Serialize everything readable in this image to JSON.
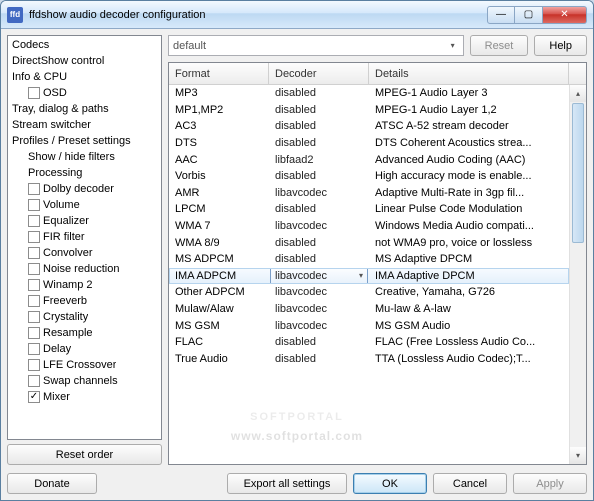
{
  "window": {
    "title": "ffdshow audio decoder configuration",
    "app_icon": "ffd"
  },
  "window_controls": {
    "min": "—",
    "max": "▢",
    "close": "✕"
  },
  "preset": {
    "value": "default",
    "reset": "Reset",
    "help": "Help"
  },
  "tree": {
    "reset_order": "Reset order",
    "items": [
      {
        "indent": 0,
        "label": "Codecs"
      },
      {
        "indent": 0,
        "label": "DirectShow control"
      },
      {
        "indent": 0,
        "label": "Info & CPU"
      },
      {
        "indent": 1,
        "checkbox": true,
        "checked": false,
        "label": "OSD"
      },
      {
        "indent": 0,
        "label": "Tray, dialog & paths"
      },
      {
        "indent": 0,
        "label": "Stream switcher"
      },
      {
        "indent": 0,
        "label": "Profiles / Preset settings"
      },
      {
        "indent": 1,
        "label": "Show / hide filters"
      },
      {
        "indent": 1,
        "label": "Processing"
      },
      {
        "indent": 1,
        "checkbox": true,
        "checked": false,
        "label": "Dolby decoder"
      },
      {
        "indent": 1,
        "checkbox": true,
        "checked": false,
        "label": "Volume"
      },
      {
        "indent": 1,
        "checkbox": true,
        "checked": false,
        "label": "Equalizer"
      },
      {
        "indent": 1,
        "checkbox": true,
        "checked": false,
        "label": "FIR filter"
      },
      {
        "indent": 1,
        "checkbox": true,
        "checked": false,
        "label": "Convolver"
      },
      {
        "indent": 1,
        "checkbox": true,
        "checked": false,
        "label": "Noise reduction"
      },
      {
        "indent": 1,
        "checkbox": true,
        "checked": false,
        "label": "Winamp 2"
      },
      {
        "indent": 1,
        "checkbox": true,
        "checked": false,
        "label": "Freeverb"
      },
      {
        "indent": 1,
        "checkbox": true,
        "checked": false,
        "label": "Crystality"
      },
      {
        "indent": 1,
        "checkbox": true,
        "checked": false,
        "label": "Resample"
      },
      {
        "indent": 1,
        "checkbox": true,
        "checked": false,
        "label": "Delay"
      },
      {
        "indent": 1,
        "checkbox": true,
        "checked": false,
        "label": "LFE Crossover"
      },
      {
        "indent": 1,
        "checkbox": true,
        "checked": false,
        "label": "Swap channels"
      },
      {
        "indent": 1,
        "checkbox": true,
        "checked": true,
        "label": "Mixer"
      }
    ]
  },
  "grid": {
    "columns": {
      "format": "Format",
      "decoder": "Decoder",
      "details": "Details"
    },
    "rows": [
      {
        "format": "MP3",
        "decoder": "disabled",
        "details": "MPEG-1 Audio Layer 3"
      },
      {
        "format": "MP1,MP2",
        "decoder": "disabled",
        "details": "MPEG-1 Audio Layer 1,2"
      },
      {
        "format": "AC3",
        "decoder": "disabled",
        "details": "ATSC A-52 stream decoder"
      },
      {
        "format": "DTS",
        "decoder": "disabled",
        "details": "DTS Coherent Acoustics strea..."
      },
      {
        "format": "AAC",
        "decoder": "libfaad2",
        "details": "Advanced Audio Coding (AAC)"
      },
      {
        "format": "Vorbis",
        "decoder": "disabled",
        "details": "High accuracy mode is enable..."
      },
      {
        "format": "AMR",
        "decoder": "libavcodec",
        "details": "Adaptive Multi-Rate in 3gp fil..."
      },
      {
        "format": "LPCM",
        "decoder": "disabled",
        "details": "Linear Pulse Code Modulation"
      },
      {
        "format": "WMA 7",
        "decoder": "libavcodec",
        "details": "Windows Media Audio compati..."
      },
      {
        "format": "WMA 8/9",
        "decoder": "disabled",
        "details": "not WMA9 pro, voice or lossless"
      },
      {
        "format": "MS ADPCM",
        "decoder": "disabled",
        "details": "MS Adaptive DPCM"
      },
      {
        "format": "IMA ADPCM",
        "decoder": "libavcodec",
        "details": "IMA Adaptive DPCM",
        "selected": true
      },
      {
        "format": "Other ADPCM",
        "decoder": "libavcodec",
        "details": "Creative, Yamaha, G726"
      },
      {
        "format": "Mulaw/Alaw",
        "decoder": "libavcodec",
        "details": "Mu-law & A-law"
      },
      {
        "format": "MS GSM",
        "decoder": "libavcodec",
        "details": "MS GSM Audio"
      },
      {
        "format": "FLAC",
        "decoder": "disabled",
        "details": "FLAC (Free Lossless Audio Co..."
      },
      {
        "format": "True Audio",
        "decoder": "disabled",
        "details": "TTA (Lossless Audio Codec);T..."
      }
    ]
  },
  "buttons": {
    "donate": "Donate",
    "export": "Export all settings",
    "ok": "OK",
    "cancel": "Cancel",
    "apply": "Apply"
  },
  "watermark": {
    "big": "SOFTPORTAL",
    "small": "www.softportal.com"
  }
}
